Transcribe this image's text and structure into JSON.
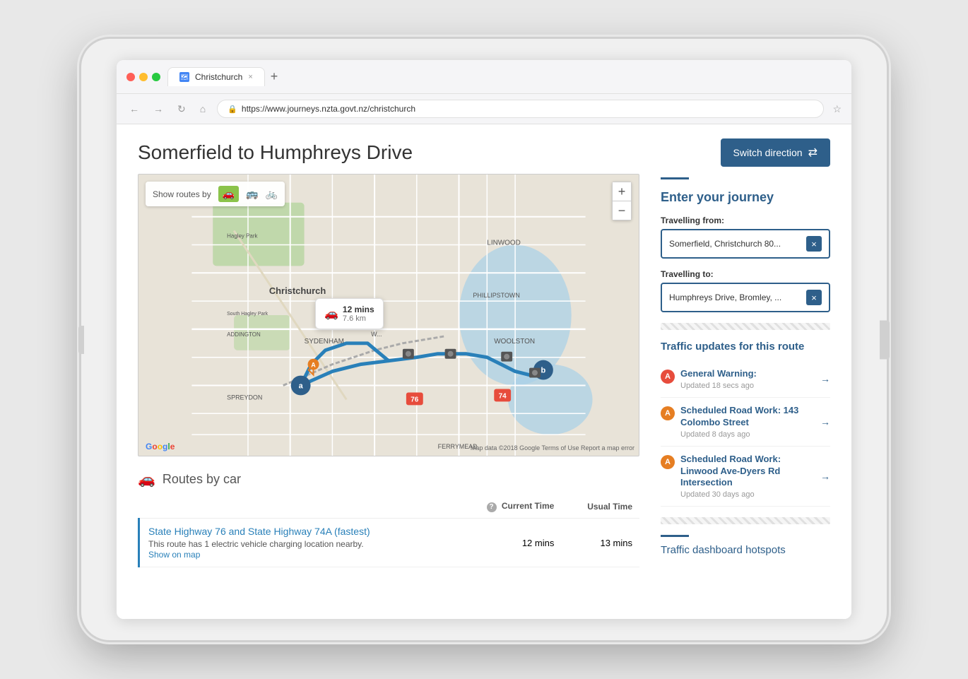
{
  "tablet": {
    "browser": {
      "tab": {
        "favicon": "🗺",
        "title": "Christchurch",
        "close": "×",
        "new_tab": "+"
      },
      "address_bar": {
        "url": "https://www.journeys.nzta.govt.nz/christchurch",
        "lock_icon": "🔒"
      }
    }
  },
  "page": {
    "title": "Somerfield to Humphreys Drive",
    "switch_direction_btn": "Switch direction",
    "map": {
      "show_routes_label": "Show routes by",
      "zoom_plus": "+",
      "zoom_minus": "−",
      "info_bubble": {
        "time": "12 mins",
        "distance": "7.6 km"
      },
      "google_logo": "Google",
      "map_credit": "Map data ©2018 Google   Terms of Use   Report a map error"
    },
    "routes_section": {
      "title": "Routes by car",
      "col_current": "Current Time",
      "col_usual": "Usual Time",
      "help_label": "?",
      "routes": [
        {
          "name": "State Highway 76 and State Highway 74A (fastest)",
          "description": "This route has 1 electric vehicle charging location nearby.",
          "show_on_map": "Show on map",
          "current_time": "12 mins",
          "usual_time": "13 mins"
        }
      ]
    },
    "journey_panel": {
      "divider_visible": true,
      "heading": "Enter your journey",
      "from_label": "Travelling from:",
      "from_value": "Somerfield, Christchurch 80...",
      "to_label": "Travelling to:",
      "to_value": "Humphreys Drive, Bromley, ...",
      "clear_icon": "×"
    },
    "traffic_panel": {
      "heading": "Traffic updates for this route",
      "items": [
        {
          "icon": "A",
          "icon_type": "red",
          "title": "General Warning:",
          "updated": "Updated 18 secs ago"
        },
        {
          "icon": "A",
          "icon_type": "orange",
          "title": "Scheduled Road Work: 143 Colombo Street",
          "updated": "Updated 8 days ago"
        },
        {
          "icon": "A",
          "icon_type": "orange",
          "title": "Scheduled Road Work: Linwood Ave-Dyers Rd Intersection",
          "updated": "Updated 30 days ago"
        }
      ],
      "arrow": "→"
    },
    "dashboard_hotspots_label": "Traffic dashboard hotspots"
  }
}
